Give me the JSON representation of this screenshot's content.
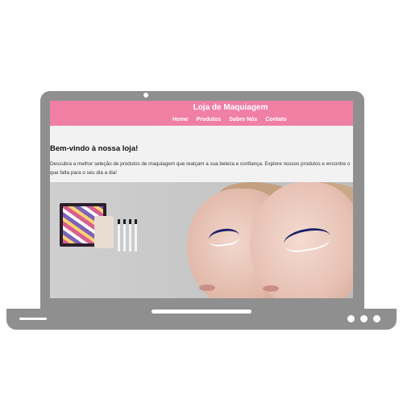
{
  "site": {
    "title": "Loja de Maquiagem",
    "nav": [
      "Home",
      "Produtos",
      "Sobre Nós",
      "Contato"
    ]
  },
  "main": {
    "welcome": "Bem-vindo à nossa loja!",
    "description": "Descubra a melhor seleção de produtos de maquiagem que realçam a sua beleza e confiança. Explore nossos produtos e encontre o que falta para o seu dia a dia!"
  },
  "colors": {
    "header": "#f07fa4",
    "frame": "#8f8f8f",
    "background": "#f2f2f2"
  }
}
